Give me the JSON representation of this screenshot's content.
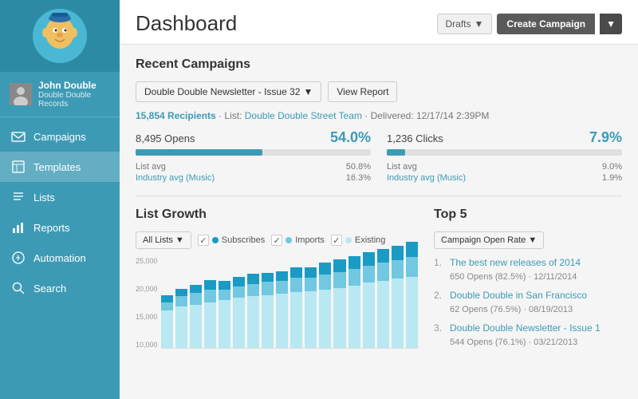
{
  "sidebar": {
    "user": {
      "name": "John Double",
      "sub": "Double Double Records"
    },
    "nav": [
      {
        "id": "campaigns",
        "label": "Campaigns",
        "icon": "email"
      },
      {
        "id": "templates",
        "label": "Templates",
        "icon": "template",
        "active": true
      },
      {
        "id": "lists",
        "label": "Lists",
        "icon": "list"
      },
      {
        "id": "reports",
        "label": "Reports",
        "icon": "reports"
      },
      {
        "id": "automation",
        "label": "Automation",
        "icon": "automation"
      },
      {
        "id": "search",
        "label": "Search",
        "icon": "search"
      }
    ]
  },
  "header": {
    "title": "Dashboard",
    "drafts_label": "Drafts",
    "create_label": "Create Campaign"
  },
  "recent_campaigns": {
    "section_title": "Recent Campaigns",
    "campaign_name": "Double Double Newsletter - Issue 32",
    "view_report": "View Report",
    "recipients_count": "15,854 Recipients",
    "list_name": "Double Double Street Team",
    "delivered": "Delivered: 12/17/14 2:39PM",
    "opens_count": "8,495 Opens",
    "opens_pct": "54.0%",
    "opens_fill": 54,
    "clicks_count": "1,236 Clicks",
    "clicks_pct": "7.9%",
    "clicks_fill": 7.9,
    "opens_list_avg_label": "List avg",
    "opens_list_avg_val": "50.8%",
    "opens_industry_label": "Industry avg (Music)",
    "opens_industry_val": "16.3%",
    "clicks_list_avg_label": "List avg",
    "clicks_list_avg_val": "9.0%",
    "clicks_industry_label": "Industry avg (Music)",
    "clicks_industry_val": "1.9%"
  },
  "list_growth": {
    "section_title": "List Growth",
    "all_lists_label": "All Lists",
    "checkboxes": [
      {
        "label": "Subscribes",
        "color": "#1a9bc4",
        "checked": true
      },
      {
        "label": "Imports",
        "color": "#71c8e0",
        "checked": true
      },
      {
        "label": "Existing",
        "color": "#b8e8f2",
        "checked": true
      }
    ],
    "y_labels": [
      "25,000",
      "20,000",
      "15,000",
      "10,000"
    ],
    "bars": [
      {
        "existing": 45,
        "imports": 10,
        "subscribes": 8
      },
      {
        "existing": 50,
        "imports": 12,
        "subscribes": 9
      },
      {
        "existing": 52,
        "imports": 14,
        "subscribes": 10
      },
      {
        "existing": 55,
        "imports": 15,
        "subscribes": 11
      },
      {
        "existing": 57,
        "imports": 13,
        "subscribes": 10
      },
      {
        "existing": 60,
        "imports": 14,
        "subscribes": 11
      },
      {
        "existing": 62,
        "imports": 15,
        "subscribes": 12
      },
      {
        "existing": 63,
        "imports": 16,
        "subscribes": 11
      },
      {
        "existing": 65,
        "imports": 15,
        "subscribes": 12
      },
      {
        "existing": 67,
        "imports": 17,
        "subscribes": 13
      },
      {
        "existing": 68,
        "imports": 16,
        "subscribes": 13
      },
      {
        "existing": 70,
        "imports": 18,
        "subscribes": 14
      },
      {
        "existing": 72,
        "imports": 19,
        "subscribes": 15
      },
      {
        "existing": 75,
        "imports": 20,
        "subscribes": 15
      },
      {
        "existing": 78,
        "imports": 21,
        "subscribes": 16
      },
      {
        "existing": 80,
        "imports": 22,
        "subscribes": 17
      },
      {
        "existing": 83,
        "imports": 22,
        "subscribes": 17
      },
      {
        "existing": 85,
        "imports": 24,
        "subscribes": 18
      }
    ]
  },
  "top5": {
    "section_title": "Top 5",
    "dropdown_label": "Campaign Open Rate",
    "items": [
      {
        "num": "1.",
        "title": "The best new releases of 2014",
        "meta": "650 Opens (82.5%) · 12/11/2014"
      },
      {
        "num": "2.",
        "title": "Double Double in San Francisco",
        "meta": "62 Opens (76.5%) · 08/19/2013"
      },
      {
        "num": "3.",
        "title": "Double Double Newsletter - Issue 1",
        "meta": "544 Opens (76.1%) · 03/21/2013"
      }
    ]
  }
}
